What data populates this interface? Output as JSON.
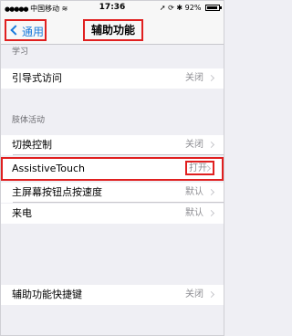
{
  "status_bar": {
    "carrier": "中国移动",
    "time": "17:36",
    "battery": "92%",
    "battery_level": 0.92
  },
  "nav": {
    "back_label": "通用",
    "title": "辅助功能"
  },
  "section_learning": {
    "header": "学习",
    "items": [
      {
        "label": "引导式访问",
        "value": "关闭"
      }
    ]
  },
  "section_interaction": {
    "header": "肢体活动",
    "items": [
      {
        "label": "切换控制",
        "value": "关闭"
      },
      {
        "label": "AssistiveTouch",
        "value": "打开"
      },
      {
        "label": "主屏幕按钮点按速度",
        "value": "默认"
      },
      {
        "label": "来电",
        "value": "默认"
      }
    ]
  },
  "section_shortcut": {
    "items": [
      {
        "label": "辅助功能快捷键",
        "value": "关闭"
      }
    ]
  },
  "colors": {
    "accent": "#1a7bdc",
    "highlight": "#e02020",
    "background": "#efeff4"
  }
}
